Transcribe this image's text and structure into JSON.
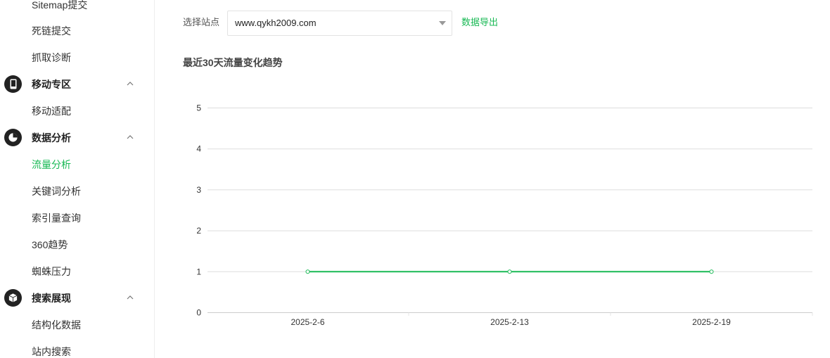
{
  "sidebar": {
    "items": [
      {
        "label": "Sitemap提交"
      },
      {
        "label": "死链提交"
      },
      {
        "label": "抓取诊断"
      },
      {
        "label": "移动专区",
        "group": true,
        "icon": "phone-icon"
      },
      {
        "label": "移动适配"
      },
      {
        "label": "数据分析",
        "group": true,
        "icon": "pie-chart-icon"
      },
      {
        "label": "流量分析",
        "active": true
      },
      {
        "label": "关键词分析"
      },
      {
        "label": "索引量查询"
      },
      {
        "label": "360趋势"
      },
      {
        "label": "蜘蛛压力"
      },
      {
        "label": "搜索展现",
        "group": true,
        "icon": "cube-icon"
      },
      {
        "label": "结构化数据"
      },
      {
        "label": "站内搜索"
      }
    ]
  },
  "toolbar": {
    "site_label": "选择站点",
    "site_value": "www.qykh2009.com",
    "export_label": "数据导出"
  },
  "main": {
    "chart_title": "最近30天流量变化趋势"
  },
  "colors": {
    "accent": "#19b955",
    "grid": "#dddddd",
    "text": "#333333"
  },
  "chart_data": {
    "type": "line",
    "title": "最近30天流量变化趋势",
    "x": [
      "2025-2-6",
      "2025-2-13",
      "2025-2-19"
    ],
    "series": [
      {
        "values": [
          1,
          1,
          1
        ]
      }
    ],
    "yticks": [
      0,
      1,
      2,
      3,
      4,
      5
    ],
    "ylim": [
      0,
      5
    ],
    "grid": true,
    "xlabel": "",
    "ylabel": ""
  }
}
